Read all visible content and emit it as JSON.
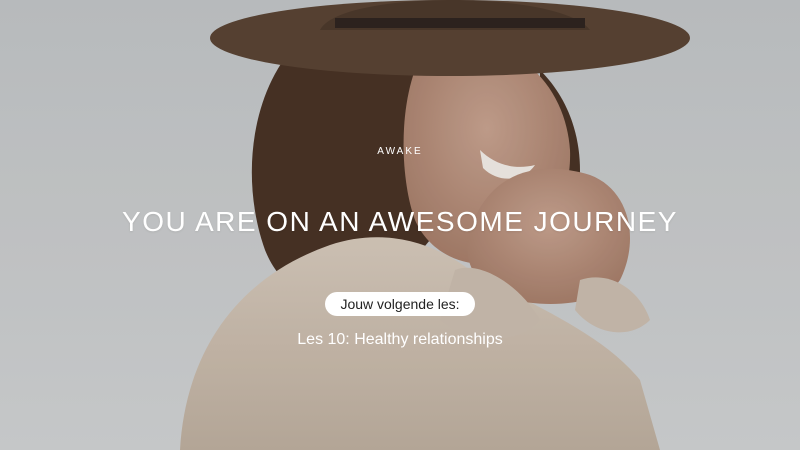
{
  "brand": {
    "logo_text": "AWAKE"
  },
  "hero": {
    "headline": "YOU ARE ON AN AWESOME JOURNEY",
    "next_lesson_label": "Jouw volgende les:",
    "next_lesson_title": "Les 10: Healthy relationships"
  },
  "colors": {
    "text": "#ffffff",
    "pill_background": "#ffffff",
    "pill_text": "#222222",
    "sky": "#c9ccce"
  }
}
